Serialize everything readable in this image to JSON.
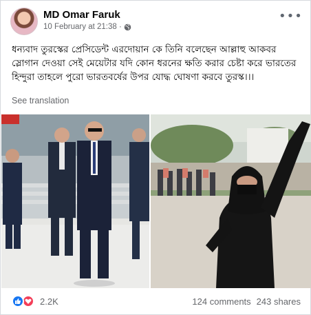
{
  "post": {
    "author": "MD Omar Faruk",
    "timestamp": "10 February at 21:38 ·",
    "privacy_icon": "globe-icon",
    "more_icon": "more-options-icon",
    "text": "ধন্যবাদ তুরস্কের প্রেসিডেন্ট এরদোয়ান কে তিনি বলেছেন আল্লাহু আকবর স্লোগান দেওয়া সেই মেয়েটার যদি কোন ধরনের ক্ষতি করার চেষ্টা করে ভারতের হিন্দুরা তাহলে পুরো ভারতবর্ষের উপর যোদ্ধ ঘোষণা করবে তুরস্ক।।।",
    "see_translation": "See translation"
  },
  "footer": {
    "reaction_count": "2.2K",
    "comments": "124 comments",
    "shares": "243 shares",
    "colors": {
      "like": "#1877f2",
      "love": "#f33e58"
    }
  }
}
